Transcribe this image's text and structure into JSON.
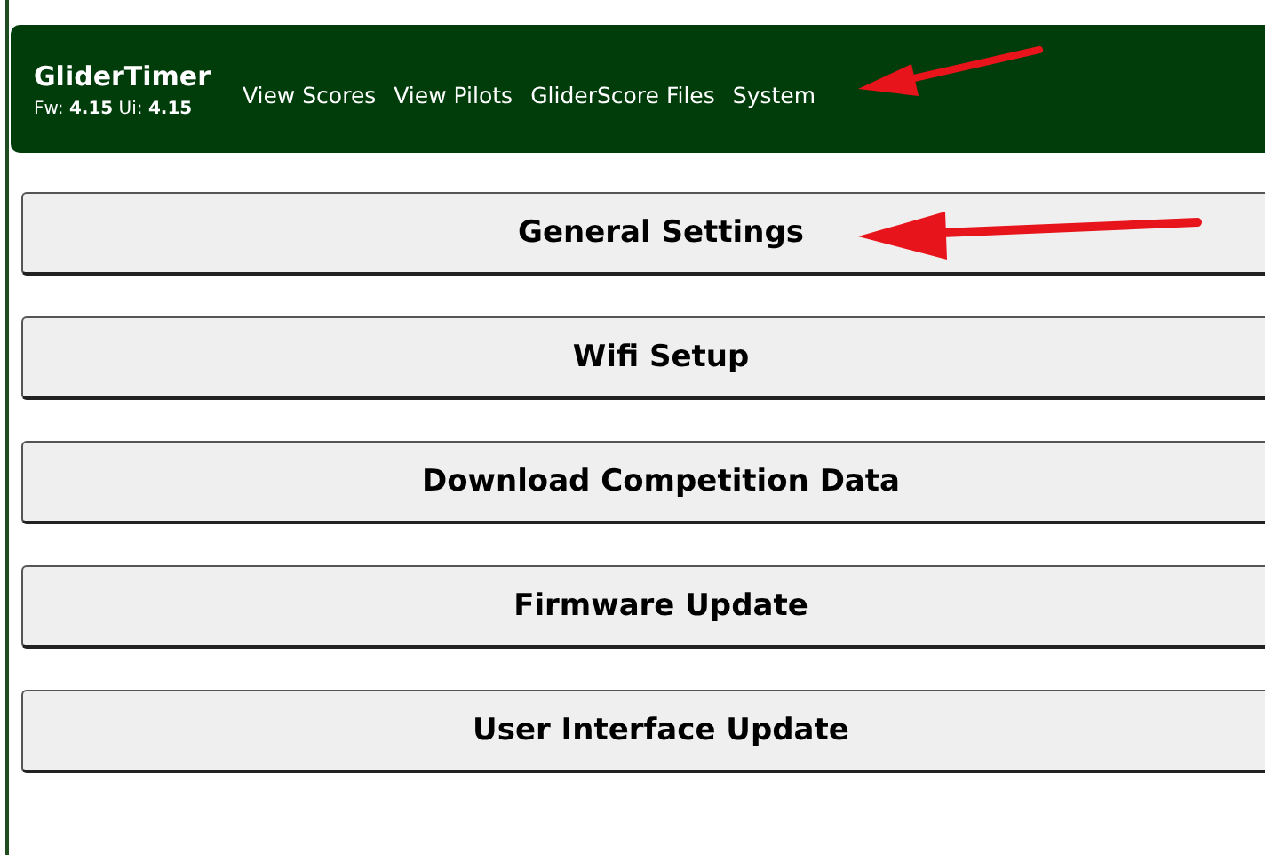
{
  "navbar": {
    "brand": "GliderTimer",
    "versions": "Fw: **4.15** Ui: **4.15**",
    "links": [
      "View Scores",
      "View Pilots",
      "GliderScore Files",
      "System"
    ]
  },
  "buttons": [
    "General Settings",
    "Wifi Setup",
    "Download Competition Data",
    "Firmware Update",
    "User Interface Update"
  ]
}
